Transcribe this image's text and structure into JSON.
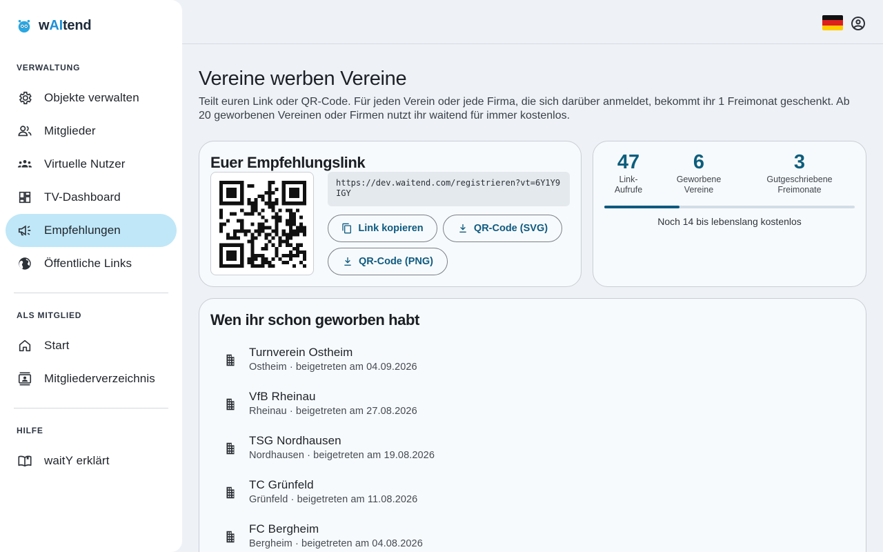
{
  "brand": {
    "name_prefix": "w",
    "name_ai": "AI",
    "name_suffix": "tend"
  },
  "sidebar": {
    "sections": [
      {
        "title": "VERWALTUNG"
      },
      {
        "title": "ALS MITGLIED"
      },
      {
        "title": "HILFE"
      }
    ],
    "items": [
      {
        "label": "Objekte verwalten",
        "icon": "gear-icon"
      },
      {
        "label": "Mitglieder",
        "icon": "people-icon"
      },
      {
        "label": "Virtuelle Nutzer",
        "icon": "groups-icon"
      },
      {
        "label": "TV-Dashboard",
        "icon": "dashboard-icon"
      },
      {
        "label": "Empfehlungen",
        "icon": "campaign-icon",
        "active": true
      },
      {
        "label": "Öffentliche Links",
        "icon": "globe-icon"
      },
      {
        "label": "Start",
        "icon": "home-icon"
      },
      {
        "label": "Mitgliederverzeichnis",
        "icon": "contacts-icon"
      },
      {
        "label": "waitY erklärt",
        "icon": "book-icon"
      }
    ]
  },
  "topbar": {
    "language_icon": "german-flag-icon",
    "account_icon": "account-circle-icon"
  },
  "main": {
    "title": "Vereine werben Vereine",
    "description": "Teilt euren Link oder QR-Code. Für jeden Verein oder jede Firma, die sich darüber anmeldet, bekommt ihr 1 Freimonat geschenkt. Ab 20 geworbenen Vereinen oder Firmen nutzt ihr waitend für immer kostenlos.",
    "referral_card": {
      "title": "Euer Empfehlungslink",
      "link": "https://dev.waitend.com/registrieren?vt=6Y1Y9IGY",
      "copy_label": "Link kopieren",
      "qr_svg_label": "QR-Code (SVG)",
      "qr_png_label": "QR-Code (PNG)"
    },
    "stats_card": {
      "stats": [
        {
          "value": "47",
          "label": "Link-\nAufrufe"
        },
        {
          "value": "6",
          "label": "Geworbene\nVereine"
        },
        {
          "value": "3",
          "label": "Gutgeschriebene\nFreimonate"
        }
      ],
      "progress_fraction": 0.3,
      "progress_text": "Noch 14 bis lebenslang kostenlos"
    },
    "referrals_card": {
      "title": "Wen ihr schon geworben habt",
      "items": [
        {
          "name": "Turnverein Ostheim",
          "detail": "Ostheim · beigetreten am 04.09.2026"
        },
        {
          "name": "VfB Rheinau",
          "detail": "Rheinau · beigetreten am 27.08.2026"
        },
        {
          "name": "TSG Nordhausen",
          "detail": "Nordhausen · beigetreten am 19.08.2026"
        },
        {
          "name": "TC Grünfeld",
          "detail": "Grünfeld · beigetreten am 11.08.2026"
        },
        {
          "name": "FC Bergheim",
          "detail": "Bergheim · beigetreten am 04.08.2026"
        }
      ]
    }
  },
  "colors": {
    "accent": "#0d5a80",
    "active_nav": "#bfe7f8",
    "brand_blue": "#1e8fd6"
  }
}
